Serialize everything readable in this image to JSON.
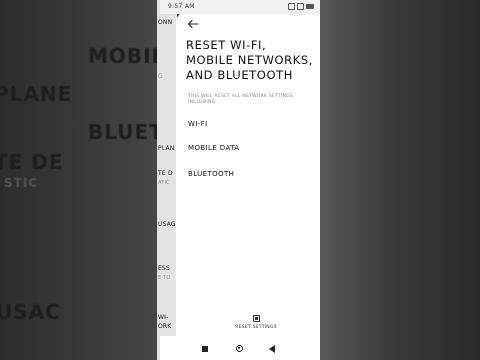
{
  "status_bar": {
    "time": "9:57 AM"
  },
  "background_left": {
    "labels": [
      "MOBILE",
      "BLUETOOTH",
      "PLANE",
      "TE DE",
      "STIC",
      "USAC"
    ],
    "strip_labels": [
      {
        "text": "ONN"
      },
      {
        "text": "G"
      },
      {
        "text": "PLAN"
      },
      {
        "text": "TE D"
      },
      {
        "text": "ATIC"
      },
      {
        "text": "USAG"
      },
      {
        "text": "ESS"
      },
      {
        "text": "E TO"
      },
      {
        "text": "WI-"
      },
      {
        "text": "ORK"
      }
    ]
  },
  "sheet": {
    "title": "RESET WI-FI, MOBILE NETWORKS, AND BLUETOOTH",
    "subtitle": "THIS WILL RESET ALL NETWORK SETTINGS, INCLUDING:",
    "items": [
      "WI-FI",
      "MOBILE DATA",
      "BLUETOOTH"
    ],
    "reset_label": "RESET SETTINGS"
  },
  "nav": {
    "icons": [
      "recents-square-icon",
      "home-circle-icon",
      "back-triangle-icon"
    ]
  }
}
